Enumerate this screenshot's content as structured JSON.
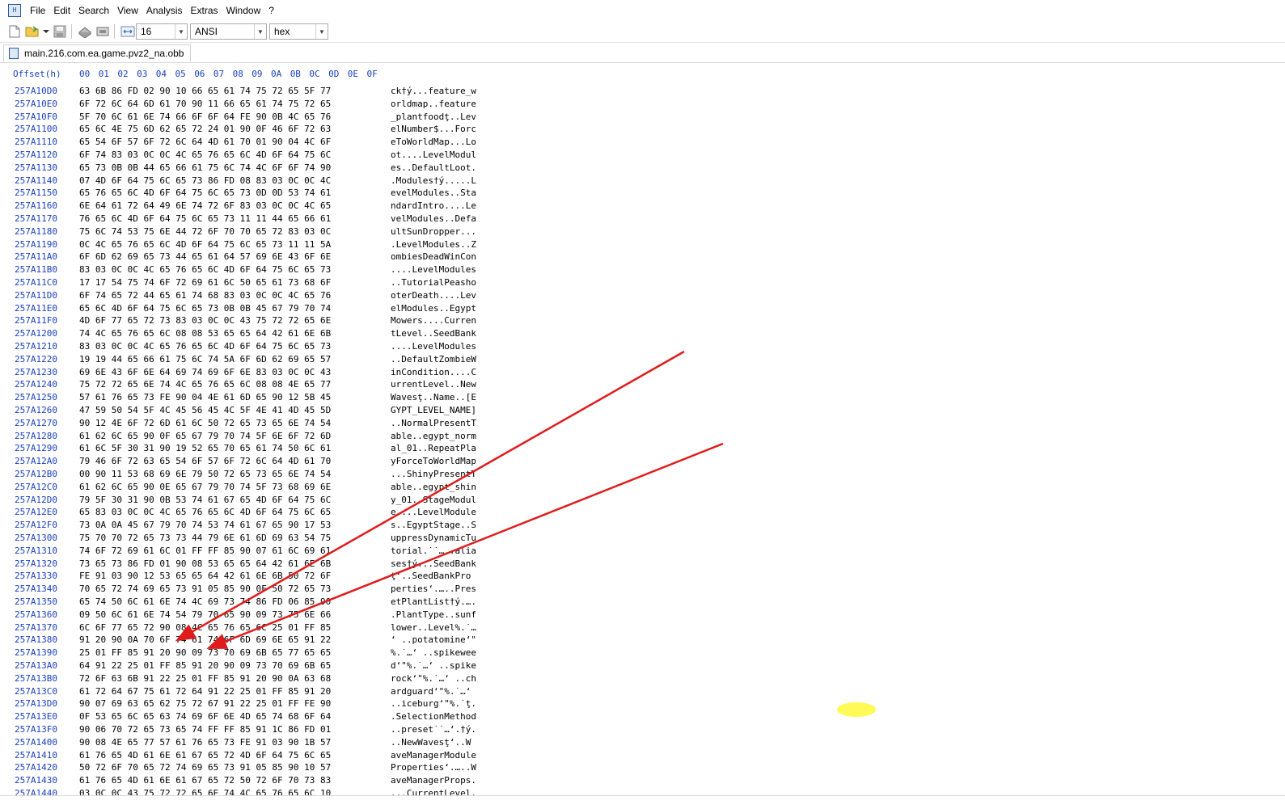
{
  "menu": [
    "File",
    "Edit",
    "Search",
    "View",
    "Analysis",
    "Extras",
    "Window",
    "?"
  ],
  "toolbar": {
    "bytes_per_row": "16",
    "charset": "ANSI",
    "display_mode": "hex"
  },
  "tab": {
    "filename": "main.216.com.ea.game.pvz2_na.obb"
  },
  "hex_view": {
    "offset_header": "Offset(h)",
    "column_header": "00 01 02 03 04 05 06 07 08 09 0A 0B 0C 0D 0E 0F",
    "rows": [
      {
        "offset": "257A10D0",
        "hex": "63 6B 86 FD 02 90 10 66 65 61 74 75 72 65 5F 77",
        "ascii": "ck†ý...feature_w"
      },
      {
        "offset": "257A10E0",
        "hex": "6F 72 6C 64 6D 61 70 90 11 66 65 61 74 75 72 65",
        "ascii": "orldmap..feature"
      },
      {
        "offset": "257A10F0",
        "hex": "5F 70 6C 61 6E 74 66 6F 6F 64 FE 90 0B 4C 65 76",
        "ascii": "_plantfoodţ..Lev"
      },
      {
        "offset": "257A1100",
        "hex": "65 6C 4E 75 6D 62 65 72 24 01 90 0F 46 6F 72 63",
        "ascii": "elNumber$...Forc"
      },
      {
        "offset": "257A1110",
        "hex": "65 54 6F 57 6F 72 6C 64 4D 61 70 01 90 04 4C 6F",
        "ascii": "eToWorldMap...Lo"
      },
      {
        "offset": "257A1120",
        "hex": "6F 74 83 03 0C 0C 4C 65 76 65 6C 4D 6F 64 75 6C",
        "ascii": "ot....LevelModul"
      },
      {
        "offset": "257A1130",
        "hex": "65 73 0B 0B 44 65 66 61 75 6C 74 4C 6F 6F 74 90",
        "ascii": "es..DefaultLoot."
      },
      {
        "offset": "257A1140",
        "hex": "07 4D 6F 64 75 6C 65 73 86 FD 08 83 03 0C 0C 4C",
        "ascii": ".Modules†ý.....L"
      },
      {
        "offset": "257A1150",
        "hex": "65 76 65 6C 4D 6F 64 75 6C 65 73 0D 0D 53 74 61",
        "ascii": "evelModules..Sta"
      },
      {
        "offset": "257A1160",
        "hex": "6E 64 61 72 64 49 6E 74 72 6F 83 03 0C 0C 4C 65",
        "ascii": "ndardIntro....Le"
      },
      {
        "offset": "257A1170",
        "hex": "76 65 6C 4D 6F 64 75 6C 65 73 11 11 44 65 66 61",
        "ascii": "velModules..Defa"
      },
      {
        "offset": "257A1180",
        "hex": "75 6C 74 53 75 6E 44 72 6F 70 70 65 72 83 03 0C",
        "ascii": "ultSunDropper..."
      },
      {
        "offset": "257A1190",
        "hex": "0C 4C 65 76 65 6C 4D 6F 64 75 6C 65 73 11 11 5A",
        "ascii": ".LevelModules..Z"
      },
      {
        "offset": "257A11A0",
        "hex": "6F 6D 62 69 65 73 44 65 61 64 57 69 6E 43 6F 6E",
        "ascii": "ombiesDeadWinCon"
      },
      {
        "offset": "257A11B0",
        "hex": "83 03 0C 0C 4C 65 76 65 6C 4D 6F 64 75 6C 65 73",
        "ascii": "....LevelModules"
      },
      {
        "offset": "257A11C0",
        "hex": "17 17 54 75 74 6F 72 69 61 6C 50 65 61 73 68 6F",
        "ascii": "..TutorialPeasho"
      },
      {
        "offset": "257A11D0",
        "hex": "6F 74 65 72 44 65 61 74 68 83 03 0C 0C 4C 65 76",
        "ascii": "oterDeath....Lev"
      },
      {
        "offset": "257A11E0",
        "hex": "65 6C 4D 6F 64 75 6C 65 73 0B 0B 45 67 79 70 74",
        "ascii": "elModules..Egypt"
      },
      {
        "offset": "257A11F0",
        "hex": "4D 6F 77 65 72 73 83 03 0C 0C 43 75 72 72 65 6E",
        "ascii": "Mowers....Curren"
      },
      {
        "offset": "257A1200",
        "hex": "74 4C 65 76 65 6C 08 08 53 65 65 64 42 61 6E 6B",
        "ascii": "tLevel..SeedBank"
      },
      {
        "offset": "257A1210",
        "hex": "83 03 0C 0C 4C 65 76 65 6C 4D 6F 64 75 6C 65 73",
        "ascii": "....LevelModules"
      },
      {
        "offset": "257A1220",
        "hex": "19 19 44 65 66 61 75 6C 74 5A 6F 6D 62 69 65 57",
        "ascii": "..DefaultZombieW"
      },
      {
        "offset": "257A1230",
        "hex": "69 6E 43 6F 6E 64 69 74 69 6F 6E 83 03 0C 0C 43",
        "ascii": "inCondition....C"
      },
      {
        "offset": "257A1240",
        "hex": "75 72 72 65 6E 74 4C 65 76 65 6C 08 08 4E 65 77",
        "ascii": "urrentLevel..New"
      },
      {
        "offset": "257A1250",
        "hex": "57 61 76 65 73 FE 90 04 4E 61 6D 65 90 12 5B 45",
        "ascii": "Wavesţ..Name..[E"
      },
      {
        "offset": "257A1260",
        "hex": "47 59 50 54 5F 4C 45 56 45 4C 5F 4E 41 4D 45 5D",
        "ascii": "GYPT_LEVEL_NAME]"
      },
      {
        "offset": "257A1270",
        "hex": "90 12 4E 6F 72 6D 61 6C 50 72 65 73 65 6E 74 54",
        "ascii": "..NormalPresentT"
      },
      {
        "offset": "257A1280",
        "hex": "61 62 6C 65 90 0F 65 67 79 70 74 5F 6E 6F 72 6D",
        "ascii": "able..egypt_norm"
      },
      {
        "offset": "257A1290",
        "hex": "61 6C 5F 30 31 90 19 52 65 70 65 61 74 50 6C 61",
        "ascii": "al_01..RepeatPla"
      },
      {
        "offset": "257A12A0",
        "hex": "79 46 6F 72 63 65 54 6F 57 6F 72 6C 64 4D 61 70",
        "ascii": "yForceToWorldMap"
      },
      {
        "offset": "257A12B0",
        "hex": "00 90 11 53 68 69 6E 79 50 72 65 73 65 6E 74 54",
        "ascii": "...ShinyPresentT"
      },
      {
        "offset": "257A12C0",
        "hex": "61 62 6C 65 90 0E 65 67 79 70 74 5F 73 68 69 6E",
        "ascii": "able..egypt_shin"
      },
      {
        "offset": "257A12D0",
        "hex": "79 5F 30 31 90 0B 53 74 61 67 65 4D 6F 64 75 6C",
        "ascii": "y_01..StageModul"
      },
      {
        "offset": "257A12E0",
        "hex": "65 83 03 0C 0C 4C 65 76 65 6C 4D 6F 64 75 6C 65",
        "ascii": "e....LevelModule"
      },
      {
        "offset": "257A12F0",
        "hex": "73 0A 0A 45 67 79 70 74 53 74 61 67 65 90 17 53",
        "ascii": "s..EgyptStage..S"
      },
      {
        "offset": "257A1300",
        "hex": "75 70 70 72 65 73 73 44 79 6E 61 6D 69 63 54 75",
        "ascii": "uppressDynamicTu"
      },
      {
        "offset": "257A1310",
        "hex": "74 6F 72 69 61 6C 01 FF FF 85 90 07 61 6C 69 61",
        "ascii": "torial.˙˙…..alia"
      },
      {
        "offset": "257A1320",
        "hex": "73 65 73 86 FD 01 90 08 53 65 65 64 42 61 6E 6B",
        "ascii": "ses†ý...SeedBank"
      },
      {
        "offset": "257A1330",
        "hex": "FE 91 03 90 12 53 65 65 64 42 61 6E 6B 50 72 6F",
        "ascii": "ţ‘..SeedBankPro"
      },
      {
        "offset": "257A1340",
        "hex": "70 65 72 74 69 65 73 91 05 85 90 0F 50 72 65 73",
        "ascii": "perties‘.…..Pres"
      },
      {
        "offset": "257A1350",
        "hex": "65 74 50 6C 61 6E 74 4C 69 73 74 86 FD 06 85 90",
        "ascii": "etPlantList†ý.…."
      },
      {
        "offset": "257A1360",
        "hex": "09 50 6C 61 6E 74 54 79 70 65 90 09 73 75 6E 66",
        "ascii": ".PlantType..sunf"
      },
      {
        "offset": "257A1370",
        "hex": "6C 6F 77 65 72 90 08 4C 65 76 65 6C 25 01 FF 85",
        "ascii": "lower..Level%.˙…"
      },
      {
        "offset": "257A1380",
        "hex": "91 20 90 0A 70 6F 74 61 74 6F 6D 69 6E 65 91 22",
        "ascii": "‘ ..potatomine‘\""
      },
      {
        "offset": "257A1390",
        "hex": "25 01 FF 85 91 20 90 09 73 70 69 6B 65 77 65 65",
        "ascii": "%.˙…‘ ..spikewee"
      },
      {
        "offset": "257A13A0",
        "hex": "64 91 22 25 01 FF 85 91 20 90 09 73 70 69 6B 65",
        "ascii": "d‘\"%.˙…‘ ..spike"
      },
      {
        "offset": "257A13B0",
        "hex": "72 6F 63 6B 91 22 25 01 FF 85 91 20 90 0A 63 68",
        "ascii": "rock‘\"%.˙…‘ ..ch"
      },
      {
        "offset": "257A13C0",
        "hex": "61 72 64 67 75 61 72 64 91 22 25 01 FF 85 91 20",
        "ascii": "ardguard‘\"%.˙…‘ "
      },
      {
        "offset": "257A13D0",
        "hex": "90 07 69 63 65 62 75 72 67 91 22 25 01 FF FE 90",
        "ascii": "..iceburg‘\"%.˙ţ."
      },
      {
        "offset": "257A13E0",
        "hex": "0F 53 65 6C 65 63 74 69 6F 6E 4D 65 74 68 6F 64",
        "ascii": ".SelectionMethod"
      },
      {
        "offset": "257A13F0",
        "hex": "90 06 70 72 65 73 65 74 FF FF 85 91 1C 86 FD 01",
        "ascii": "..preset˙˙…‘.†ý."
      },
      {
        "offset": "257A1400",
        "hex": "90 08 4E 65 77 57 61 76 65 73 FE 91 03 90 1B 57",
        "ascii": "..NewWavesţ‘..W"
      },
      {
        "offset": "257A1410",
        "hex": "61 76 65 4D 61 6E 61 67 65 72 4D 6F 64 75 6C 65",
        "ascii": "aveManagerModule"
      },
      {
        "offset": "257A1420",
        "hex": "50 72 6F 70 65 72 74 69 65 73 91 05 85 90 10 57",
        "ascii": "Properties‘.…..W"
      },
      {
        "offset": "257A1430",
        "hex": "61 76 65 4D 61 6E 61 67 65 72 50 72 6F 70 73 83",
        "ascii": "aveManagerProps."
      },
      {
        "offset": "257A1440",
        "hex": "03 0C 0C 43 75 72 72 65 6E 74 4C 65 76 65 6C 10",
        "ascii": "...CurrentLevel."
      }
    ]
  },
  "annotations": {
    "arrow_color": "#e01b1b",
    "highlight_color": "#fffa55"
  }
}
